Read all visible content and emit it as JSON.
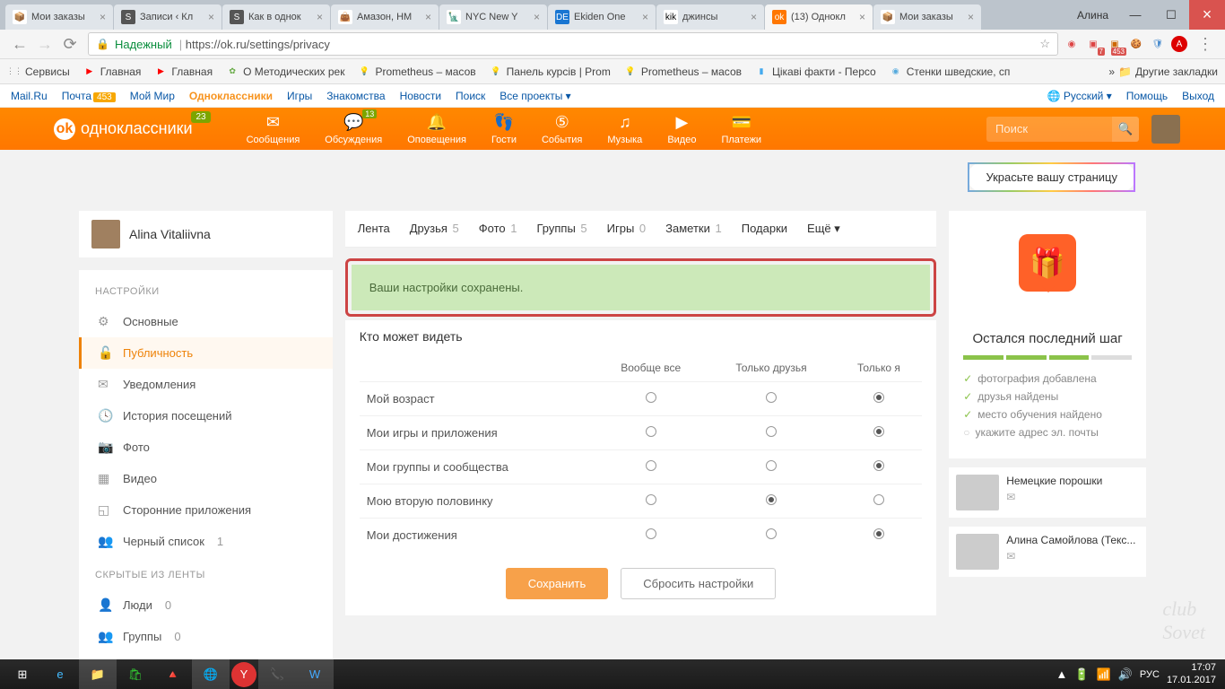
{
  "browser": {
    "tabs": [
      {
        "label": "Мои заказы",
        "favBg": "#fff",
        "favTxt": "📦"
      },
      {
        "label": "Записи ‹ Кл",
        "favBg": "#555",
        "favTxt": "S"
      },
      {
        "label": "Как в однок",
        "favBg": "#555",
        "favTxt": "S"
      },
      {
        "label": "Амазон, HM",
        "favBg": "#fff",
        "favTxt": "👜"
      },
      {
        "label": "NYC New Y",
        "favBg": "#fff",
        "favTxt": "🗽"
      },
      {
        "label": "Ekiden One",
        "favBg": "#1976d2",
        "favTxt": "DE"
      },
      {
        "label": "джинсы",
        "favBg": "#fff",
        "favTxt": "kik"
      },
      {
        "label": "(13) Однокл",
        "favBg": "#ff7700",
        "favTxt": "ok",
        "active": true
      },
      {
        "label": "Мои заказы",
        "favBg": "#fff",
        "favTxt": "📦"
      }
    ],
    "winUser": "Алина",
    "back": "←",
    "fwd": "→",
    "reload": "⟳",
    "secure": "Надежный",
    "url": "https://ok.ru/settings/privacy",
    "extBadge1": "7",
    "extBadge2": "453",
    "moreBookmarks": "Другие закладки"
  },
  "bookmarks": [
    {
      "label": "Сервисы",
      "ico": "⋮⋮",
      "bg": "#888"
    },
    {
      "label": "Главная",
      "ico": "▶",
      "bg": "#f00"
    },
    {
      "label": "Главная",
      "ico": "▶",
      "bg": "#f00"
    },
    {
      "label": "О Методических рек",
      "ico": "✿",
      "bg": "#6a4"
    },
    {
      "label": "Prometheus – масов",
      "ico": "💡",
      "bg": "#fff"
    },
    {
      "label": "Панель курсів | Prom",
      "ico": "💡",
      "bg": "#fff"
    },
    {
      "label": "Prometheus – масов",
      "ico": "💡",
      "bg": "#fff"
    },
    {
      "label": "Цікаві факти - Персо",
      "ico": "▮",
      "bg": "#4ae"
    },
    {
      "label": "Стенки шведские, сп",
      "ico": "◉",
      "bg": "#5ad"
    }
  ],
  "mailru": {
    "items": [
      "Mail.Ru",
      "Почта",
      "Мой Мир",
      "Одноклассники",
      "Игры",
      "Знакомства",
      "Новости",
      "Поиск",
      "Все проекты"
    ],
    "badge": "453",
    "lang": "Русский",
    "help": "Помощь",
    "exit": "Выход"
  },
  "okheader": {
    "brand": "одноклассники",
    "brandBadge": "23",
    "nav": [
      {
        "label": "Сообщения",
        "ico": "✉"
      },
      {
        "label": "Обсуждения",
        "ico": "💬",
        "badge": "13"
      },
      {
        "label": "Оповещения",
        "ico": "🔔"
      },
      {
        "label": "Гости",
        "ico": "👣"
      },
      {
        "label": "События",
        "ico": "⑤"
      },
      {
        "label": "Музыка",
        "ico": "♫"
      },
      {
        "label": "Видео",
        "ico": "▶"
      },
      {
        "label": "Платежи",
        "ico": "💳"
      }
    ],
    "searchPlaceholder": "Поиск"
  },
  "decorate": "Украсьте вашу страницу",
  "user": {
    "name": "Alina Vitaliivna"
  },
  "profileNav": [
    {
      "label": "Лента"
    },
    {
      "label": "Друзья",
      "cnt": "5"
    },
    {
      "label": "Фото",
      "cnt": "1"
    },
    {
      "label": "Группы",
      "cnt": "5"
    },
    {
      "label": "Игры",
      "cnt": "0"
    },
    {
      "label": "Заметки",
      "cnt": "1",
      "active": true
    },
    {
      "label": "Подарки"
    },
    {
      "label": "Ещё ▾"
    }
  ],
  "settingsMenu": {
    "title": "НАСТРОЙКИ",
    "hiddenTitle": "СКРЫТЫЕ ИЗ ЛЕНТЫ",
    "items": [
      {
        "label": "Основные",
        "ico": "⚙"
      },
      {
        "label": "Публичность",
        "ico": "🔓",
        "active": true
      },
      {
        "label": "Уведомления",
        "ico": "✉"
      },
      {
        "label": "История посещений",
        "ico": "🕓"
      },
      {
        "label": "Фото",
        "ico": "📷"
      },
      {
        "label": "Видео",
        "ico": "▦"
      },
      {
        "label": "Сторонние приложения",
        "ico": "◱"
      },
      {
        "label": "Черный список",
        "ico": "👥",
        "cnt": "1"
      }
    ],
    "hidden": [
      {
        "label": "Люди",
        "ico": "👤",
        "cnt": "0"
      },
      {
        "label": "Группы",
        "ico": "👥",
        "cnt": "0"
      }
    ]
  },
  "alert": "Ваши настройки сохранены.",
  "privacy": {
    "title": "Кто может видеть",
    "cols": [
      "",
      "Вообще все",
      "Только друзья",
      "Только я"
    ],
    "rows": [
      {
        "label": "Мой возраст",
        "sel": 2
      },
      {
        "label": "Мои игры и приложения",
        "sel": 2
      },
      {
        "label": "Мои группы и сообщества",
        "sel": 2
      },
      {
        "label": "Мою вторую половинку",
        "sel": 1
      },
      {
        "label": "Мои достижения",
        "sel": 2
      }
    ],
    "save": "Сохранить",
    "reset": "Сбросить настройки"
  },
  "promo": {
    "title": "Остался последний шаг",
    "checks": [
      {
        "label": "фотография добавлена",
        "done": true
      },
      {
        "label": "друзья найдены",
        "done": true
      },
      {
        "label": "место обучения найдено",
        "done": true
      },
      {
        "label": "укажите адрес эл. почты",
        "done": false
      }
    ]
  },
  "ads": [
    {
      "label": "Немецкие порошки"
    },
    {
      "label": "Алина Самойлова (Текс..."
    }
  ],
  "taskbar": {
    "lang": "РУС",
    "time": "17:07",
    "date": "17.01.2017"
  },
  "watermark": "club\nSovet"
}
